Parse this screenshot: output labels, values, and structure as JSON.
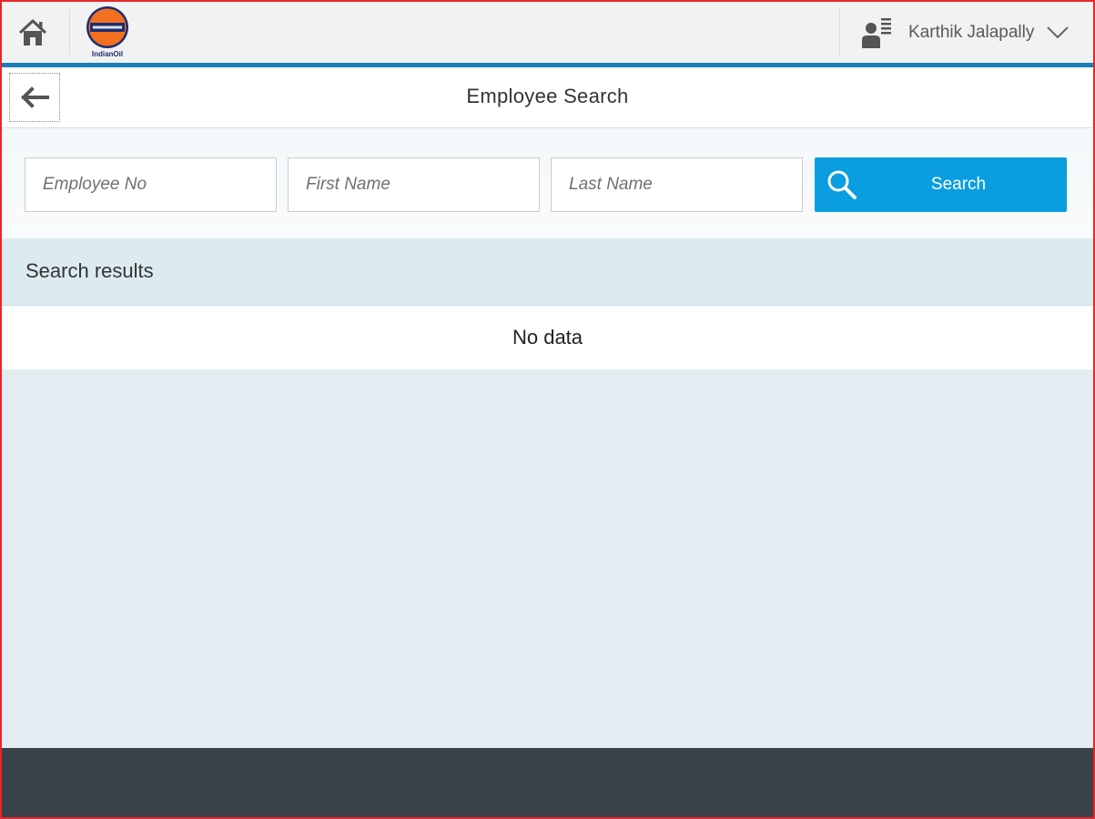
{
  "shell": {
    "logo_caption": "IndianOil",
    "user_name": "Karthik Jalapally"
  },
  "page": {
    "title": "Employee Search"
  },
  "search": {
    "employee_no_placeholder": "Employee No",
    "first_name_placeholder": "First Name",
    "last_name_placeholder": "Last Name",
    "button_label": "Search"
  },
  "results": {
    "title": "Search results",
    "empty_text": "No data"
  },
  "colors": {
    "accent_bar": "#1a7fb6",
    "search_button": "#0a9ee0",
    "footer": "#3a424a",
    "frame_border": "#e8262b"
  },
  "icons": [
    "home-icon",
    "indianoil-logo",
    "user-list-icon",
    "chevron-down-icon",
    "back-arrow-icon",
    "search-icon"
  ]
}
